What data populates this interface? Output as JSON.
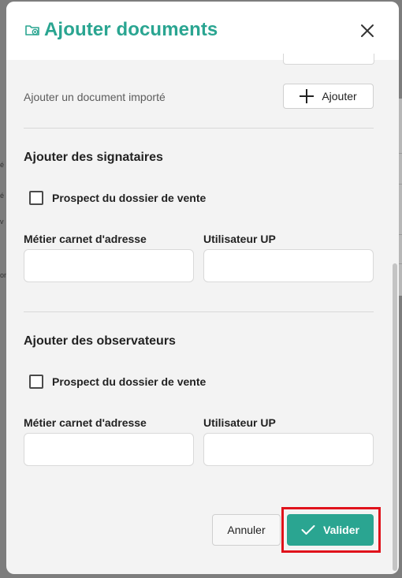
{
  "background": {
    "fragments": [
      "é",
      "é",
      "on",
      "",
      "v"
    ]
  },
  "modal": {
    "title": "Ajouter documents",
    "header_icon": "folder-add-icon",
    "close_icon": "close-icon"
  },
  "import": {
    "label": "Ajouter un document importé",
    "button_label": "Ajouter",
    "button_icon": "plus-icon"
  },
  "signataires": {
    "title": "Ajouter des signataires",
    "checkbox_label": "Prospect du dossier de vente",
    "checked": false,
    "field1_label": "Métier carnet d'adresse",
    "field1_value": "",
    "field2_label": "Utilisateur UP",
    "field2_value": ""
  },
  "observateurs": {
    "title": "Ajouter des observateurs",
    "checkbox_label": "Prospect du dossier de vente",
    "checked": false,
    "field1_label": "Métier carnet d'adresse",
    "field1_value": "",
    "field2_label": "Utilisateur UP",
    "field2_value": ""
  },
  "footer": {
    "cancel_label": "Annuler",
    "submit_label": "Valider",
    "submit_icon": "check-icon"
  },
  "colors": {
    "accent": "#2aa591",
    "highlight": "#e0121b"
  }
}
